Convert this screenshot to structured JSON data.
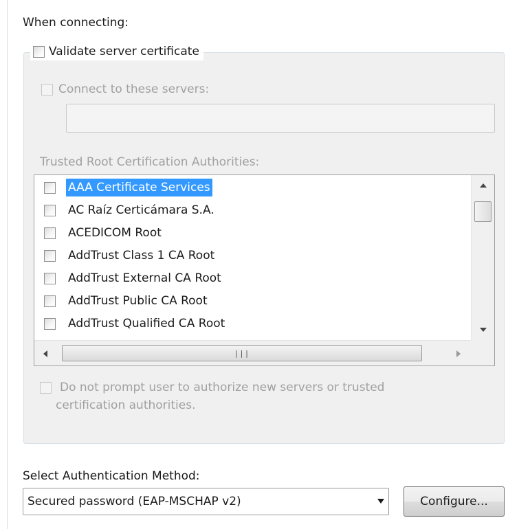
{
  "when_connecting_label": "When connecting:",
  "validate_server_certificate": {
    "label": "Validate server certificate",
    "checked": false
  },
  "connect_to_servers": {
    "label": "Connect to these servers:",
    "checked": false,
    "value": ""
  },
  "trusted_root_label": "Trusted Root Certification Authorities:",
  "trusted_roots": [
    {
      "name": "AAA Certificate Services",
      "checked": false,
      "selected": true
    },
    {
      "name": "AC Raíz Certicámara S.A.",
      "checked": false,
      "selected": false
    },
    {
      "name": "ACEDICOM Root",
      "checked": false,
      "selected": false
    },
    {
      "name": "AddTrust Class 1 CA Root",
      "checked": false,
      "selected": false
    },
    {
      "name": "AddTrust External CA Root",
      "checked": false,
      "selected": false
    },
    {
      "name": "AddTrust Public CA Root",
      "checked": false,
      "selected": false
    },
    {
      "name": "AddTrust Qualified CA Root",
      "checked": false,
      "selected": false
    }
  ],
  "do_not_prompt": {
    "line1": "Do not prompt user to authorize new servers or trusted",
    "line2": "certification authorities.",
    "checked": false
  },
  "auth_method_label": "Select Authentication Method:",
  "auth_method_value": "Secured password (EAP-MSCHAP v2)",
  "configure_button": "Configure...",
  "colors": {
    "selection": "#3399ff",
    "disabled_text": "#a0a0a0",
    "group_background": "#f0f0f0"
  }
}
